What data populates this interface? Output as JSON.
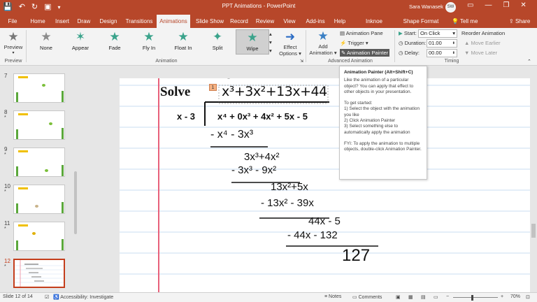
{
  "window": {
    "title": "PPT Animations  -  PowerPoint",
    "user_name": "Sara Wanasek",
    "user_initials": "SW"
  },
  "ribbon_tabs": [
    "File",
    "Home",
    "Insert",
    "Draw",
    "Design",
    "Transitions",
    "Animations",
    "Slide Show",
    "Record",
    "Review",
    "View",
    "Add-ins",
    "Help",
    "Inknoe ClassPoint",
    "Shape Format"
  ],
  "tell_me": "Tell me",
  "share": "Share",
  "preview": {
    "label": "Preview",
    "group": "Preview"
  },
  "animation_gallery": [
    "None",
    "Appear",
    "Fade",
    "Fly In",
    "Float In",
    "Split",
    "Wipe"
  ],
  "animation_group_label": "Animation",
  "effect_options": {
    "line1": "Effect",
    "line2": "Options"
  },
  "add_animation": {
    "line1": "Add",
    "line2": "Animation"
  },
  "advanced": {
    "animation_pane": "Animation Pane",
    "trigger": "Trigger",
    "animation_painter": "Animation Painter",
    "group": "Advanced Animation"
  },
  "timing": {
    "start_label": "Start:",
    "start_value": "On Click",
    "duration_label": "Duration:",
    "duration_value": "01.00",
    "delay_label": "Delay:",
    "delay_value": "00.00",
    "reorder": "Reorder Animation",
    "move_earlier": "Move Earlier",
    "move_later": "Move Later",
    "group": "Timing"
  },
  "slides": [
    {
      "number": "7",
      "star": ""
    },
    {
      "number": "8",
      "star": "*"
    },
    {
      "number": "9",
      "star": "*"
    },
    {
      "number": "10",
      "star": "*"
    },
    {
      "number": "11",
      "star": "*"
    },
    {
      "number": "12",
      "star": "*"
    }
  ],
  "slide_content": {
    "solve": "Solve",
    "tag": "1",
    "divisor": "x - 3",
    "dividend": "x⁴ + 0x³ + 4x² + 5x - 5",
    "quotient": "x³+3x²+13x+44",
    "steps": [
      "- x⁴ - 3x³",
      "3x³+4x²",
      "- 3x³ - 9x²",
      "13x²+5x",
      "- 13x² - 39x",
      "44x - 5",
      "- 44x - 132",
      "127"
    ]
  },
  "tooltip": {
    "title": "Animation Painter (Alt+Shift+C)",
    "p1": "Like the animation of a particular object? You can apply that effect to other objects in your presentation.",
    "p2": "To get started:",
    "s1": "1) Select the object with the animation you like",
    "s2": "2) Click Animation Painter",
    "s3": "3) Select something else to automatically apply the animation",
    "p3": "FYI: To apply the animation to multiple objects, double-click Animation Painter."
  },
  "status": {
    "slide": "Slide 12 of 14",
    "accessibility": "Accessibility: Investigate",
    "notes": "Notes",
    "comments": "Comments",
    "zoom": "70%"
  },
  "colors": {
    "accent": "#b7472a",
    "ribbon": "#f3f3f3",
    "red_margin": "#e8607a"
  }
}
